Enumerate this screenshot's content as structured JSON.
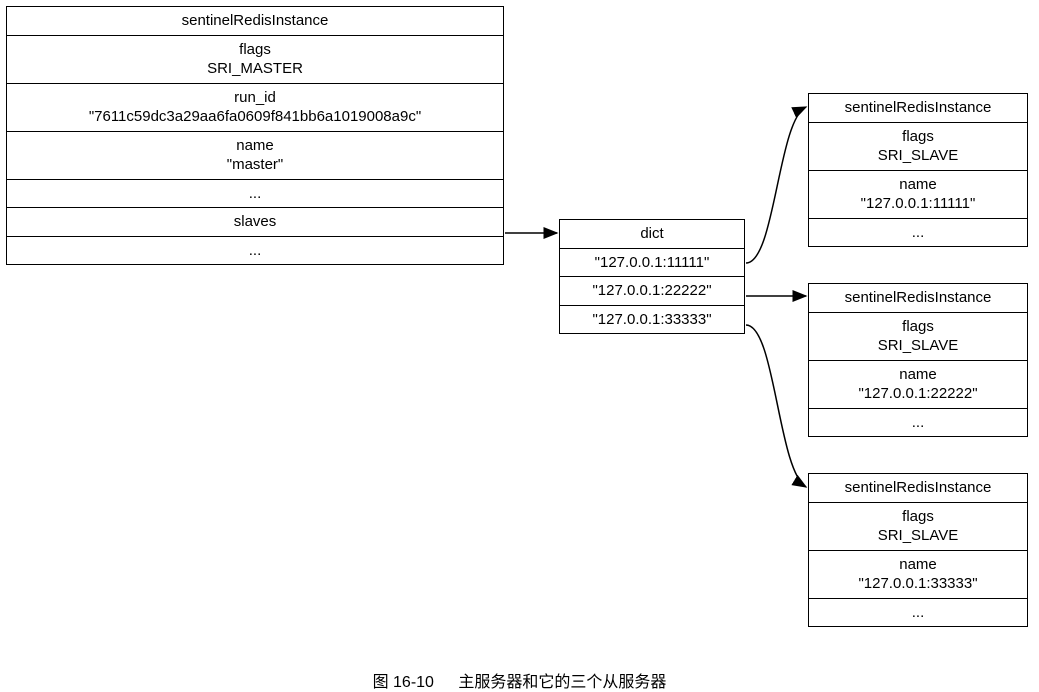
{
  "master": {
    "title": "sentinelRedisInstance",
    "flags_label": "flags",
    "flags_value": "SRI_MASTER",
    "runid_label": "run_id",
    "runid_value": "\"7611c59dc3a29aa6fa0609f841bb6a1019008a9c\"",
    "name_label": "name",
    "name_value": "\"master\"",
    "ellipsis1": "...",
    "slaves_label": "slaves",
    "ellipsis2": "..."
  },
  "dict": {
    "title": "dict",
    "k0": "\"127.0.0.1:11111\"",
    "k1": "\"127.0.0.1:22222\"",
    "k2": "\"127.0.0.1:33333\""
  },
  "slave0": {
    "title": "sentinelRedisInstance",
    "flags_label": "flags",
    "flags_value": "SRI_SLAVE",
    "name_label": "name",
    "name_value": "\"127.0.0.1:11111\"",
    "ellipsis": "..."
  },
  "slave1": {
    "title": "sentinelRedisInstance",
    "flags_label": "flags",
    "flags_value": "SRI_SLAVE",
    "name_label": "name",
    "name_value": "\"127.0.0.1:22222\"",
    "ellipsis": "..."
  },
  "slave2": {
    "title": "sentinelRedisInstance",
    "flags_label": "flags",
    "flags_value": "SRI_SLAVE",
    "name_label": "name",
    "name_value": "\"127.0.0.1:33333\"",
    "ellipsis": "..."
  },
  "caption": {
    "figno": "图 16-10",
    "text": "主服务器和它的三个从服务器"
  }
}
